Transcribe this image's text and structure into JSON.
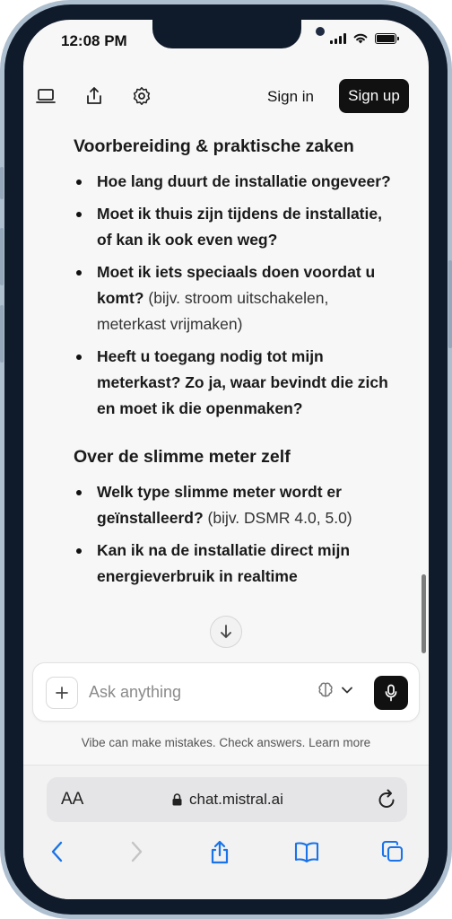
{
  "status": {
    "time": "12:08 PM"
  },
  "toolbar": {
    "sign_in": "Sign in",
    "sign_up": "Sign up"
  },
  "content": {
    "section1_title": "Voorbereiding & praktische zaken",
    "section1_items": [
      {
        "bold": "Hoe lang duurt de installatie ongeveer?",
        "rest": ""
      },
      {
        "bold": "Moet ik thuis zijn tijdens de installatie, of kan ik ook even weg?",
        "rest": ""
      },
      {
        "bold": "Moet ik iets speciaals doen voordat u komt?",
        "rest": " (bijv. stroom uitschakelen, meterkast vrijmaken)"
      },
      {
        "bold": "Heeft u toegang nodig tot mijn meterkast? Zo ja, waar bevindt die zich en moet ik die openmaken?",
        "rest": ""
      }
    ],
    "section2_title": "Over de slimme meter zelf",
    "section2_items": [
      {
        "bold": "Welk type slimme meter wordt er geïnstalleerd?",
        "rest": " (bijv. DSMR 4.0, 5.0)"
      },
      {
        "bold": "Kan ik na de installatie direct mijn energieverbruik in realtime",
        "rest": ""
      }
    ]
  },
  "composer": {
    "placeholder": "Ask anything"
  },
  "disclaimer": "Vibe can make mistakes. Check answers. Learn more",
  "browser": {
    "text_size": "AA",
    "url": "chat.mistral.ai"
  },
  "icons": [
    "laptop-icon",
    "share-icon",
    "settings-icon",
    "arrow-down-icon",
    "plus-icon",
    "brain-icon",
    "chevron-down-icon",
    "microphone-icon",
    "lock-icon",
    "reload-icon",
    "back-icon",
    "forward-icon",
    "share-icon",
    "bookmarks-icon",
    "tabs-icon"
  ]
}
